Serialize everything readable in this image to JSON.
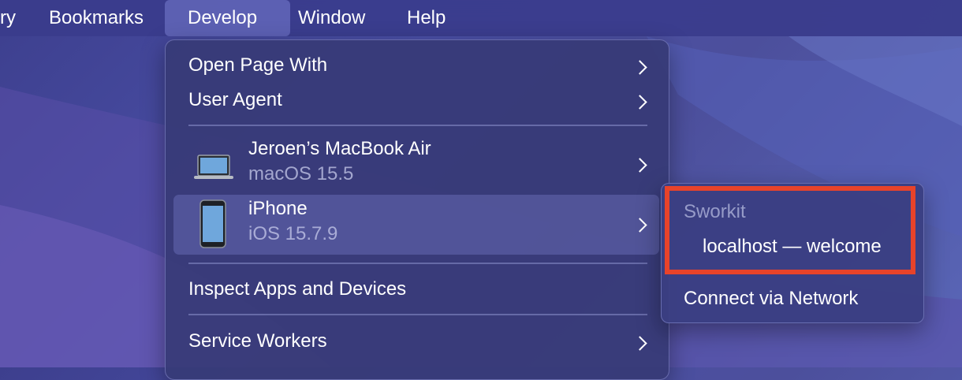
{
  "menubar": {
    "items": [
      {
        "label": "ry"
      },
      {
        "label": "Bookmarks"
      },
      {
        "label": "Develop"
      },
      {
        "label": "Window"
      },
      {
        "label": "Help"
      }
    ],
    "active_item": "Develop"
  },
  "develop_menu": {
    "open_page_with": "Open Page With",
    "user_agent": "User Agent",
    "devices": [
      {
        "name": "Jeroen’s MacBook Air",
        "os": "macOS 15.5",
        "icon": "laptop-icon"
      },
      {
        "name": "iPhone",
        "os": "iOS 15.7.9",
        "icon": "iphone-icon"
      }
    ],
    "inspect_apps": "Inspect Apps and Devices",
    "service_workers": "Service Workers"
  },
  "iphone_submenu": {
    "app_header": "Sworkit",
    "page_item": "localhost — welcome",
    "connect": "Connect via Network"
  },
  "colors": {
    "menubar_bg": "#3a3c8c",
    "menu_bg": "#373a76",
    "highlight_row": "#6e74be",
    "annotation_red": "#e8432a"
  }
}
